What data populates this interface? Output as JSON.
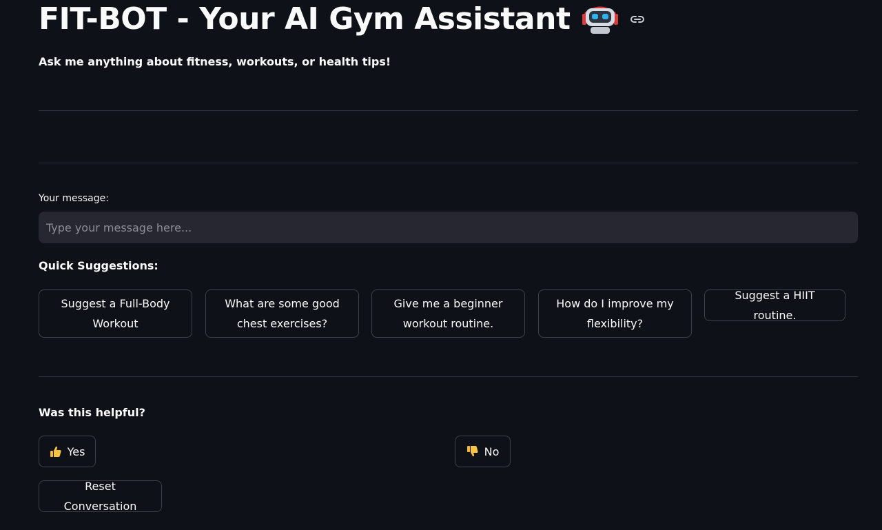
{
  "header": {
    "title": "FIT-BOT - Your AI Gym Assistant",
    "subtitle": "Ask me anything about fitness, workouts, or health tips!"
  },
  "input": {
    "label": "Your message:",
    "placeholder": "Type your message here...",
    "value": ""
  },
  "suggestions": {
    "heading": "Quick Suggestions:",
    "items": [
      "Suggest a Full-Body Workout",
      "What are some good chest exercises?",
      "Give me a beginner workout routine.",
      "How do I improve my flexibility?",
      "Suggest a HIIT routine."
    ]
  },
  "feedback": {
    "heading": "Was this helpful?",
    "yes_label": "Yes",
    "no_label": "No",
    "yes_icon": "thumbs-up-icon",
    "no_icon": "thumbs-down-icon"
  },
  "reset_label": "Reset Conversation",
  "colors": {
    "background": "#0e1117",
    "input_background": "#262730",
    "border": "#3f424b",
    "text": "#fafafa"
  }
}
